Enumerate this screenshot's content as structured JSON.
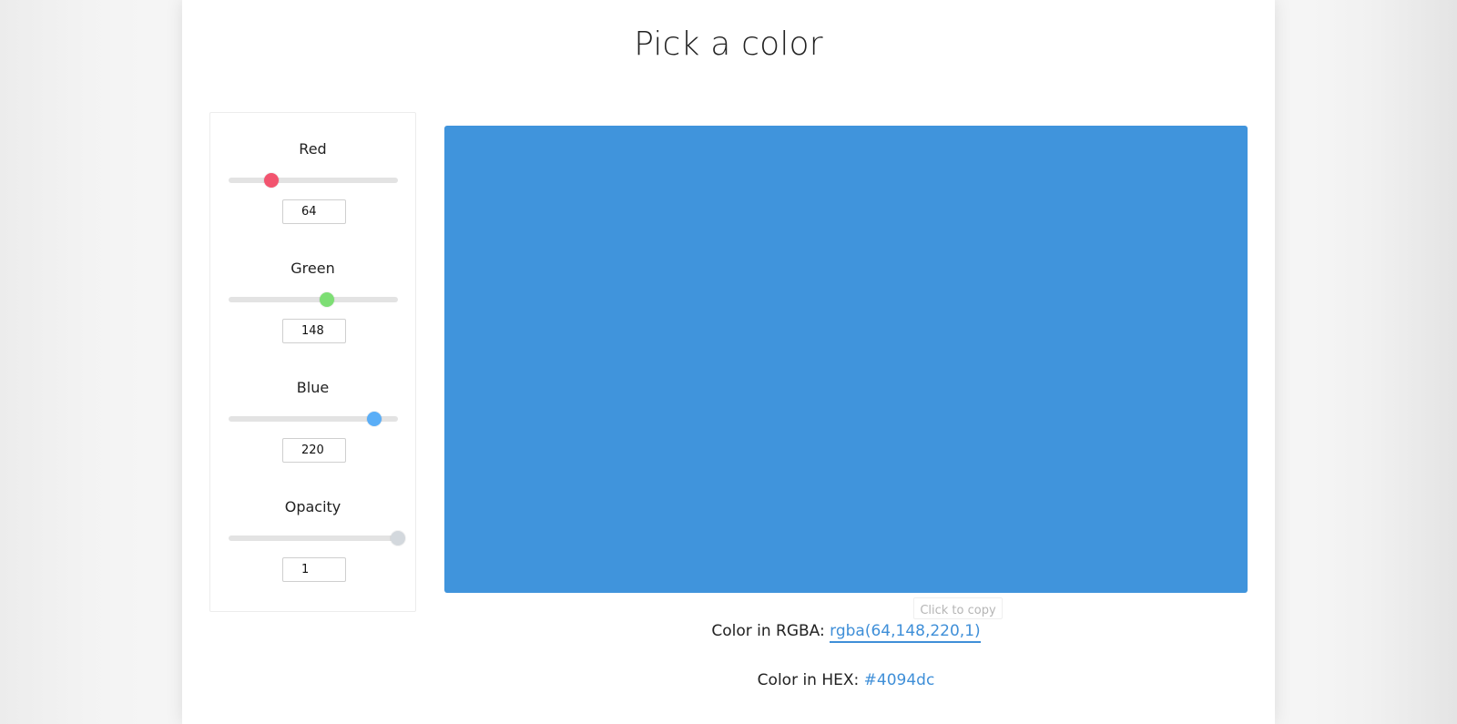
{
  "title": "Pick a color",
  "controls": [
    {
      "label": "Red",
      "value": "64",
      "min": 0,
      "max": 255,
      "current": 64,
      "thumb_color": "#f2546f"
    },
    {
      "label": "Green",
      "value": "148",
      "min": 0,
      "max": 255,
      "current": 148,
      "thumb_color": "#7dde74"
    },
    {
      "label": "Blue",
      "value": "220",
      "min": 0,
      "max": 255,
      "current": 220,
      "thumb_color": "#5aaef7"
    },
    {
      "label": "Opacity",
      "value": "1",
      "min": 0,
      "max": 1,
      "current": 1,
      "thumb_color": "#d3d8dd"
    }
  ],
  "preview": {
    "color": "#4094dc"
  },
  "tooltip": "Click to copy",
  "rgba": {
    "label": "Color in RGBA:",
    "value": "rgba(64,148,220,1)"
  },
  "hex": {
    "label": "Color in HEX:",
    "value": "#4094dc"
  },
  "colors": {
    "track": "#e3e3e3",
    "link": "#3f8fd8"
  }
}
